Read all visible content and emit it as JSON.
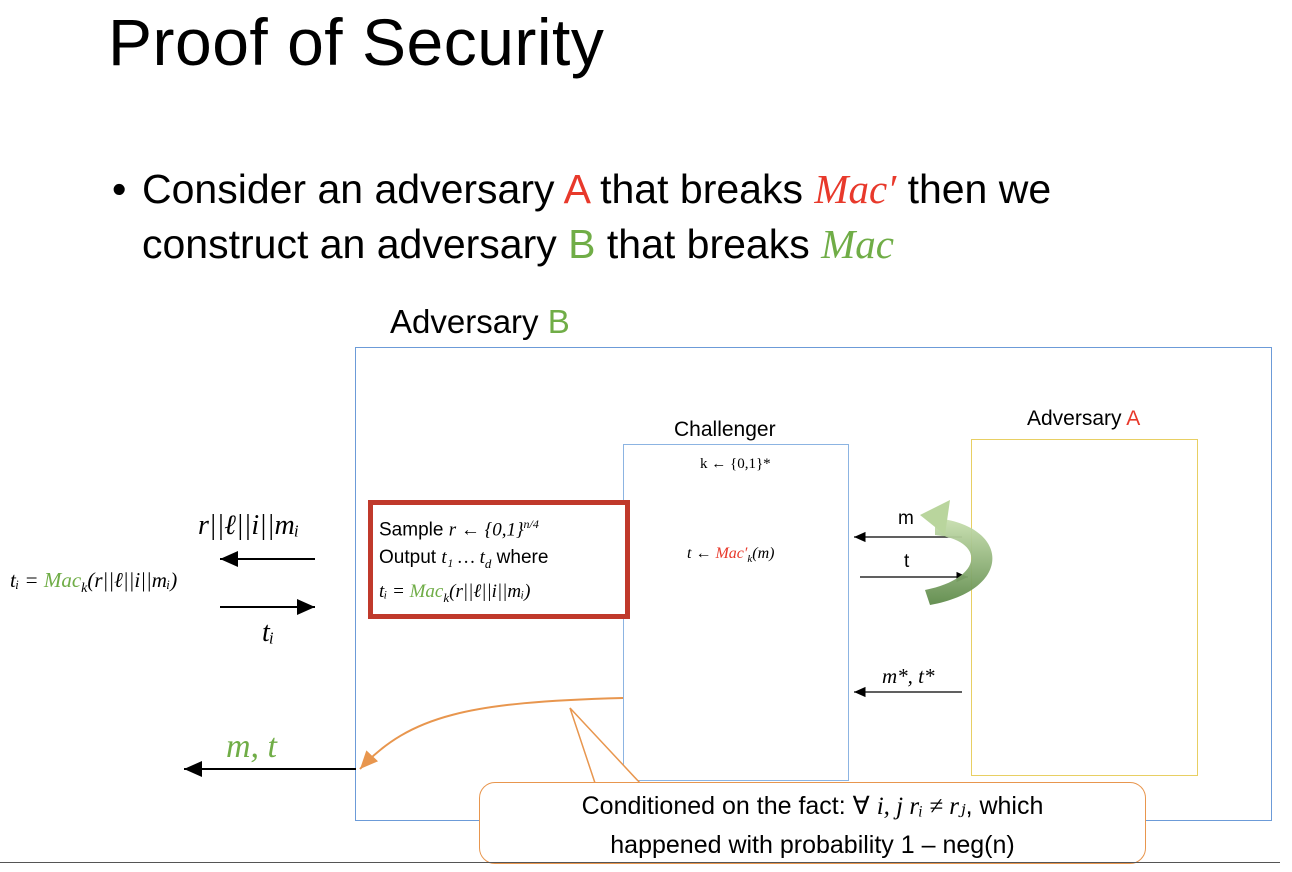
{
  "title": "Proof of Security",
  "bullet": {
    "line1_a": "Consider an adversary ",
    "line1_A": "A",
    "line1_b": " that breaks ",
    "line1_mac": "Mac′",
    "line1_c": " then we",
    "line2_a": "construct an adversary ",
    "line2_B": "B",
    "line2_b": " that breaks ",
    "line2_mac": "Mac"
  },
  "adversary_b": {
    "label": "Adversary ",
    "letter": "B"
  },
  "challenger": {
    "label": "Challenger",
    "keygen": "k ← {0,1}*",
    "tag_prefix": "t ← ",
    "tag_mac": "Mac′",
    "tag_sub": "k",
    "tag_suffix": "(m)"
  },
  "adversary_a": {
    "label": "Adversary ",
    "letter": "A"
  },
  "red_box": {
    "line1_text": "Sample ",
    "line1_math": "r ← {0,1}",
    "line1_exp": "n/4",
    "line2_text": "Output ",
    "line2_math": "t₁ … t",
    "line2_sub": "d",
    "line2_text2": " where",
    "line3_lhs": "tᵢ = ",
    "line3_mac": "Mac",
    "line3_sub": "k",
    "line3_rhs": "(r||ℓ||i||mᵢ)"
  },
  "left": {
    "query": "r||ℓ||i||mᵢ",
    "eq_lhs": "tᵢ = ",
    "eq_mac": "Mac",
    "eq_sub": "k",
    "eq_rhs": "(r||ℓ||i||mᵢ)",
    "ti": "tᵢ",
    "output": "m, t"
  },
  "arrows": {
    "m": "m",
    "t": "t",
    "mstar": "m*, t*"
  },
  "callout": {
    "line1_a": "Conditioned on the fact: ∀ ",
    "line1_math": "i, j rᵢ ≠ rⱼ",
    "line1_b": ", which",
    "line2": "happened with probability 1 – neg(n)"
  },
  "colors": {
    "red": "#e8392b",
    "green": "#70ad47",
    "blue_box": "#6c9bd8",
    "yellow_box": "#e8cf63",
    "orange": "#e8964e",
    "dark_red": "#c0392b"
  }
}
